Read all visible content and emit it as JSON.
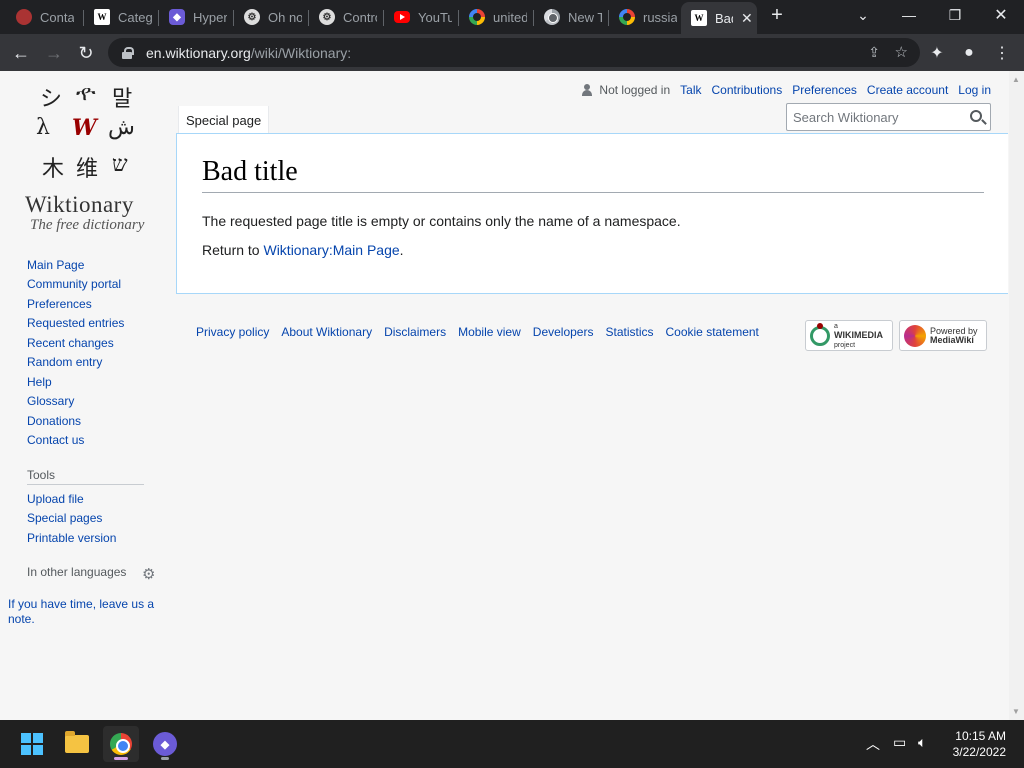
{
  "browser": {
    "tabs": [
      {
        "title": "Conta",
        "favicon": "red-globe-icon"
      },
      {
        "title": "Catego",
        "favicon": "wiktionary-icon"
      },
      {
        "title": "Hyper",
        "favicon": "hyper-icon"
      },
      {
        "title": "Oh no",
        "favicon": "github-icon"
      },
      {
        "title": "Contro",
        "favicon": "github-icon"
      },
      {
        "title": "YouTu",
        "favicon": "youtube-icon"
      },
      {
        "title": "united",
        "favicon": "google-icon"
      },
      {
        "title": "New T",
        "favicon": "chrome-icon"
      },
      {
        "title": "russia",
        "favicon": "google-icon"
      },
      {
        "title": "Bad",
        "favicon": "wiktionary-icon",
        "active": true
      }
    ],
    "new_tab": "+",
    "url_domain": "en.wiktionary.org",
    "url_path": "/wiki/Wiktionary:"
  },
  "site": {
    "logo_glyphs": [
      "シ",
      "ዯ",
      "말",
      "λ",
      "W",
      "ش",
      "木",
      "维",
      "ש"
    ],
    "logo_name": "Wiktionary",
    "logo_tagline": "The free dictionary",
    "nav": [
      "Main Page",
      "Community portal",
      "Preferences",
      "Requested entries",
      "Recent changes",
      "Random entry",
      "Help",
      "Glossary",
      "Donations",
      "Contact us"
    ],
    "tools_heading": "Tools",
    "tools": [
      "Upload file",
      "Special pages",
      "Printable version"
    ],
    "languages_heading": "In other languages",
    "note": "If you have time, leave us a note."
  },
  "personal": {
    "not_logged_in": "Not logged in",
    "links": [
      "Talk",
      "Contributions",
      "Preferences",
      "Create account",
      "Log in"
    ]
  },
  "tabs": {
    "special": "Special page"
  },
  "search": {
    "placeholder": "Search Wiktionary"
  },
  "content": {
    "title": "Bad title",
    "message": "The requested page title is empty or contains only the name of a namespace.",
    "return_prefix": "Return to ",
    "return_link": "Wiktionary:Main Page",
    "return_suffix": "."
  },
  "footer": {
    "links": [
      "Privacy policy",
      "About Wiktionary",
      "Disclaimers",
      "Mobile view",
      "Developers",
      "Statistics",
      "Cookie statement"
    ],
    "wikimedia_badge": [
      "a",
      "WIKIMEDIA",
      "project"
    ],
    "mediawiki_badge": [
      "Powered by",
      "MediaWiki"
    ]
  },
  "taskbar": {
    "time": "10:15 AM",
    "date": "3/22/2022"
  }
}
